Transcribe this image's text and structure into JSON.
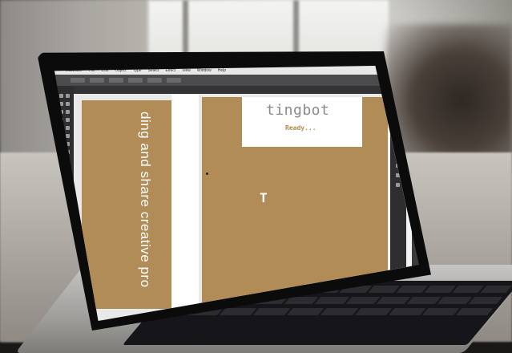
{
  "app": {
    "menu_items": [
      "Illustrator",
      "File",
      "Edit",
      "Object",
      "Type",
      "Select",
      "Effect",
      "View",
      "Window",
      "Help"
    ]
  },
  "artwork": {
    "vertical_text": "ding and share creative pro",
    "logo_text": "tingbot",
    "status_text": "Ready...",
    "icon_glyph": "T"
  },
  "icons": {
    "cursor": "arrow-pointer-icon",
    "tools": "illustrator-tools-icon"
  },
  "colors": {
    "artboard": "#b18c57",
    "logo_text": "#8a8a8a",
    "ready_text": "#b6874c",
    "ui_dark": "#3b3b3d"
  }
}
